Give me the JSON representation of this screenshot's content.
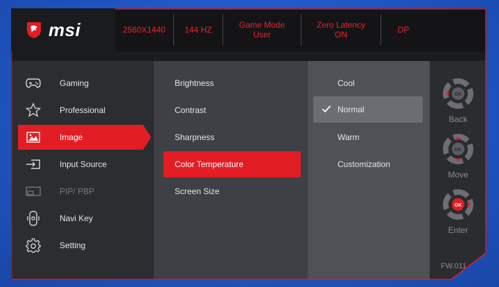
{
  "brand": {
    "name": "msi"
  },
  "status_bar": [
    {
      "line1": "2560X1440",
      "line2": ""
    },
    {
      "line1": "144 HZ",
      "line2": ""
    },
    {
      "line1": "Game Mode",
      "line2": "User"
    },
    {
      "line1": "Zero Latency",
      "line2": "ON"
    },
    {
      "line1": "DP",
      "line2": ""
    }
  ],
  "main_menu": [
    {
      "label": "Gaming",
      "icon": "gamepad-icon",
      "state": "normal"
    },
    {
      "label": "Professional",
      "icon": "star-icon",
      "state": "normal"
    },
    {
      "label": "Image",
      "icon": "image-icon",
      "state": "active"
    },
    {
      "label": "Input Source",
      "icon": "input-source-icon",
      "state": "normal"
    },
    {
      "label": "PIP/ PBP",
      "icon": "pip-icon",
      "state": "disabled"
    },
    {
      "label": "Navi Key",
      "icon": "navi-key-icon",
      "state": "normal"
    },
    {
      "label": "Setting",
      "icon": "gear-icon",
      "state": "normal"
    }
  ],
  "sub_menu": [
    {
      "label": "Brightness"
    },
    {
      "label": "Contrast"
    },
    {
      "label": "Sharpness"
    },
    {
      "label": "Color Temperature",
      "active": true
    },
    {
      "label": "Screen Size"
    }
  ],
  "options": [
    {
      "label": "Cool",
      "selected": false
    },
    {
      "label": "Normal",
      "selected": true
    },
    {
      "label": "Warm",
      "selected": false
    },
    {
      "label": "Customization",
      "selected": false
    }
  ],
  "nav_keys": [
    {
      "label": "Back",
      "center": "OK"
    },
    {
      "label": "Move",
      "center": "OK"
    },
    {
      "label": "Enter",
      "center": "OK"
    }
  ],
  "firmware": "FW.011",
  "colors": {
    "accent": "#e31d24",
    "background": "#1f56c4"
  }
}
